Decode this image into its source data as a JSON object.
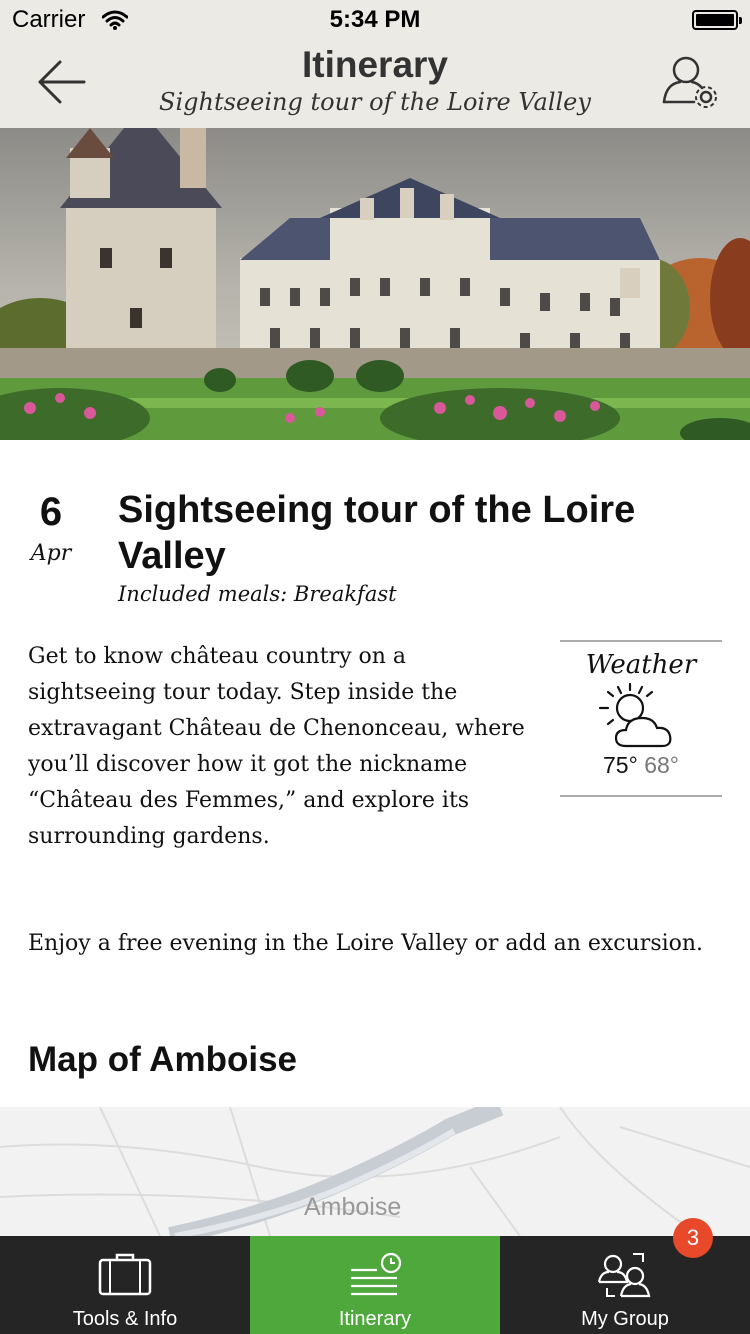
{
  "status_bar": {
    "carrier": "Carrier",
    "time": "5:34 PM"
  },
  "nav": {
    "title": "Itinerary",
    "subtitle": "Sightseeing tour of the Loire Valley",
    "back_icon": "back-arrow-icon",
    "profile_icon": "user-settings-icon"
  },
  "hero": {
    "icon": "photo-chateau-de-chenonceau"
  },
  "day": {
    "date_day": "6",
    "date_month": "Apr",
    "title": "Sightseeing tour of the Loire Valley",
    "meals_label": "Included meals: Breakfast"
  },
  "description": {
    "paragraph1": "Get to know château country on a sightseeing tour today. Step inside the extravagant Château de Chenonceau, where you’ll discover how it got the nickname “Château des Femmes,” and explore its surrounding gardens.",
    "paragraph2": "Enjoy a free evening in the Loire Valley or add an excursion."
  },
  "weather": {
    "label": "Weather",
    "high": "75°",
    "low": "68°",
    "icon": "partly-sunny-icon"
  },
  "map": {
    "heading": "Map of Amboise",
    "label": "Amboise"
  },
  "tabs": [
    {
      "label": "Tools & Info",
      "icon": "suitcase-icon",
      "active": false
    },
    {
      "label": "Itinerary",
      "icon": "itinerary-icon",
      "active": true
    },
    {
      "label": "My Group",
      "icon": "group-icon",
      "active": false,
      "badge": "3"
    }
  ],
  "colors": {
    "accent_green": "#4ea83b",
    "tabbar_bg": "#252525",
    "header_bg": "#ebeae4",
    "badge_red": "#e8492a"
  }
}
